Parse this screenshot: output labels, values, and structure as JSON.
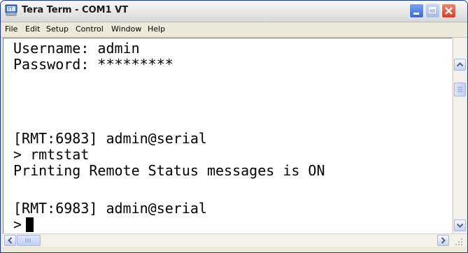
{
  "window": {
    "title": "Tera Term - COM1 VT",
    "app_icon": "teraterm-icon",
    "controls": [
      "minimize",
      "maximize",
      "close"
    ]
  },
  "menu": {
    "items": [
      "File",
      "Edit",
      "Setup",
      "Control",
      "Window",
      "Help"
    ]
  },
  "terminal": {
    "lines": [
      "Username: admin",
      "Password: *********",
      "",
      "",
      "[RMT:6983] admin@serial",
      "> rmtstat",
      "Printing Remote Status messages is ON",
      "",
      "[RMT:6983] admin@serial",
      ">"
    ],
    "cursor": "block"
  },
  "colors": {
    "terminal_bg": "#ffffff",
    "terminal_fg": "#000000",
    "close_button": "#c8452a",
    "minimize_button": "#3a68d4"
  }
}
